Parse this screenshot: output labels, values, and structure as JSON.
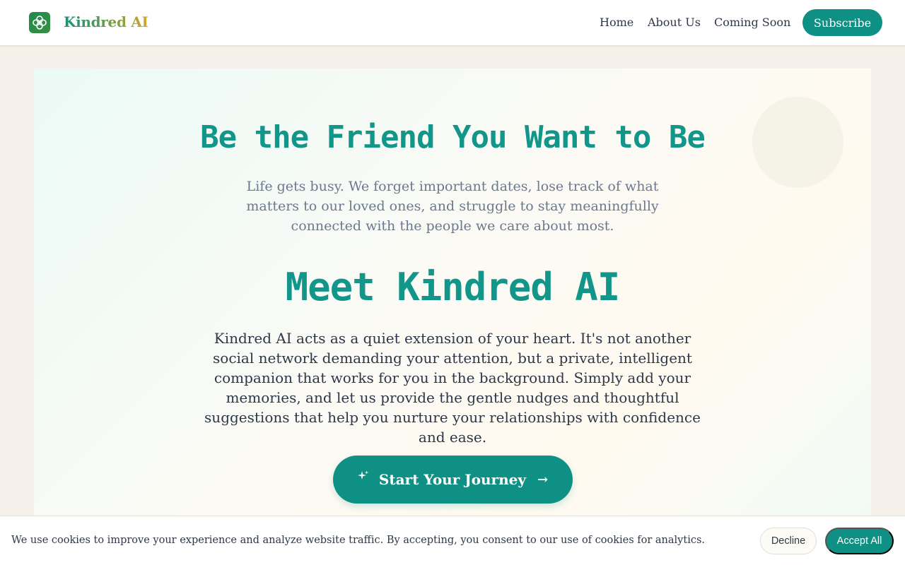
{
  "brand": {
    "name": "Kindred AI",
    "logo_icon": "flower-knot-icon"
  },
  "nav": {
    "items": [
      {
        "label": "Home"
      },
      {
        "label": "About Us"
      },
      {
        "label": "Coming Soon"
      }
    ],
    "subscribe_label": "Subscribe"
  },
  "hero": {
    "title": "Be the Friend You Want to Be",
    "subtitle": "Life gets busy. We forget important dates, lose track of what matters to our loved ones, and struggle to stay meaningfully connected with the people we care about most.",
    "meet_title": "Meet Kindred AI",
    "description": "Kindred AI acts as a quiet extension of your heart. It's not another social network demanding your attention, but a private, intelligent companion that works for you in the background. Simply add your memories, and let us provide the gentle nudges and thoughtful suggestions that help you nurture your relationships with confidence and ease.",
    "cta": {
      "label": "Start Your Journey",
      "icon": "sparkle-icon",
      "arrow": "→"
    }
  },
  "cookie_banner": {
    "text": "We use cookies to improve your experience and analyze website traffic. By accepting, you consent to our use of cookies for analytics.",
    "decline_label": "Decline",
    "accept_label": "Accept All"
  },
  "colors": {
    "accent": "#0f9084",
    "title": "#13968a",
    "background": "#f5f1ea"
  }
}
